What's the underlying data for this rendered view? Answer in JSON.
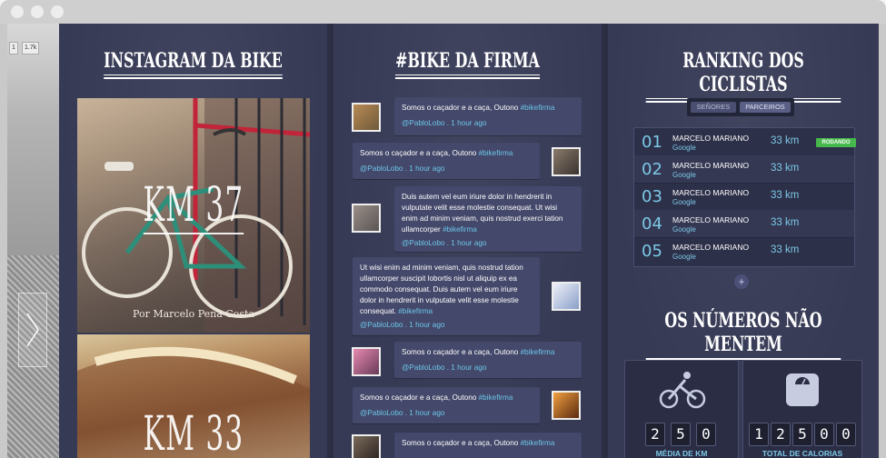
{
  "stripbadges": [
    "1",
    "1.7k"
  ],
  "instagram": {
    "title": "INSTAGRAM DA BIKE",
    "photos": [
      {
        "km": "KM 37",
        "credit": "Por Marcelo Pena Costa"
      },
      {
        "km": "KM 33",
        "credit": ""
      }
    ]
  },
  "feed": {
    "title": "#BIKE DA FIRMA",
    "tweets": [
      {
        "text": "Somos o caçador e a caça, Outono ",
        "hash": "#bikefirma",
        "meta": "@PabloLobo . 1 hour ago",
        "side": "left"
      },
      {
        "text": "Somos o caçador e a caça, Outono ",
        "hash": "#bikefirma",
        "meta": "@PabloLobo . 1 hour ago",
        "side": "right"
      },
      {
        "text": "Duis autem vel eum iriure dolor in hendrerit in vulputate velit esse molestie consequat. Ut wisi enim ad minim veniam, quis nostrud exerci tation ullamcorper ",
        "hash": "#bikefirma",
        "meta": "@PabloLobo . 1 hour ago",
        "side": "left"
      },
      {
        "text": "Ut wisi enim ad minim veniam, quis nostrud tation ullamcorper suscipit lobortis nisl ut aliquip ex ea commodo consequat. Duis autem vel eum iriure dolor in hendrerit in vulputate velit esse molestie consequat. ",
        "hash": "#bikefirma",
        "meta": "@PabloLobo . 1 hour ago",
        "side": "right"
      },
      {
        "text": "Somos o caçador e a caça, Outono ",
        "hash": "#bikefirma",
        "meta": "@PabloLobo . 1 hour ago",
        "side": "left"
      },
      {
        "text": "Somos o caçador e a caça, Outono ",
        "hash": "#bikefirma",
        "meta": "@PabloLobo . 1 hour ago",
        "side": "right"
      },
      {
        "text": "Somos o caçador e a caça, Outono ",
        "hash": "#bikefirma",
        "meta": "",
        "side": "left"
      }
    ]
  },
  "ranking": {
    "title": "RANKING DOS CICLISTAS",
    "tabs": [
      "SEÑORES",
      "PARCEIROS"
    ],
    "rows": [
      {
        "pos": "01",
        "name": "MARCELO MARIANO",
        "company": "Google",
        "km": "33 km",
        "badge": "RODANDO"
      },
      {
        "pos": "02",
        "name": "MARCELO MARIANO",
        "company": "Google",
        "km": "33 km",
        "badge": ""
      },
      {
        "pos": "03",
        "name": "MARCELO MARIANO",
        "company": "Google",
        "km": "33 km",
        "badge": ""
      },
      {
        "pos": "04",
        "name": "MARCELO MARIANO",
        "company": "Google",
        "km": "33 km",
        "badge": ""
      },
      {
        "pos": "05",
        "name": "MARCELO MARIANO",
        "company": "Google",
        "km": "33 km",
        "badge": ""
      }
    ],
    "more": "+"
  },
  "numbers": {
    "title": "OS NÚMEROS NÃO MENTEM",
    "stats": [
      {
        "icon": "cyclist-icon",
        "digits": [
          "2",
          "5",
          "0"
        ],
        "label": "MÉDIA DE KM"
      },
      {
        "icon": "scale-icon",
        "digits": [
          "1",
          "2",
          "5",
          "0",
          "0"
        ],
        "label": "TOTAL DE CALORIAS"
      }
    ]
  },
  "colors": {
    "accent": "#6cc6e8",
    "badge": "#47b84c",
    "panel": "#363a55"
  }
}
